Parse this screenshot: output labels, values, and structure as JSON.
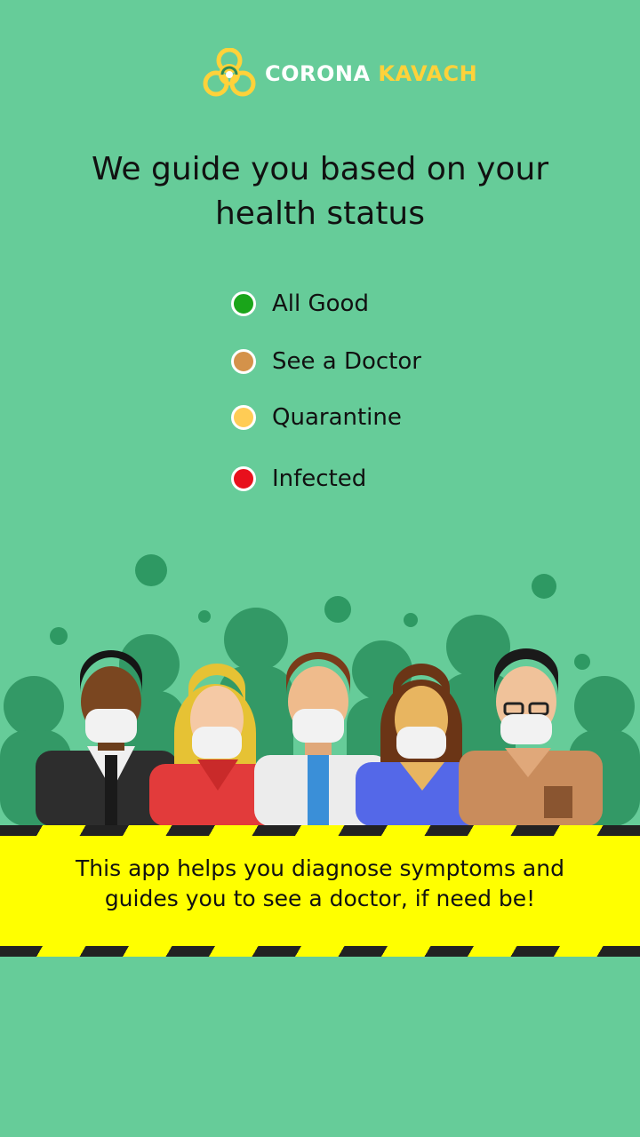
{
  "app": {
    "brand_part1": "CORONA",
    "brand_part2": "KAVACH",
    "logo_icon": "biohazard-icon"
  },
  "headline": {
    "line1": "We guide you based on your",
    "line2": "health status"
  },
  "statuses": [
    {
      "label": "All Good",
      "color": "#1aa51a"
    },
    {
      "label": "See a Doctor",
      "color": "#d4924a"
    },
    {
      "label": "Quarantine",
      "color": "#ffcc55"
    },
    {
      "label": "Infected",
      "color": "#e8101c"
    }
  ],
  "banner": {
    "line1": "This app helps you diagnose symptoms and",
    "line2": "guides you to see a doctor, if need be!"
  },
  "colors": {
    "background": "#66cc99",
    "banner": "#ffff00",
    "brand_accent": "#ffd23a"
  }
}
